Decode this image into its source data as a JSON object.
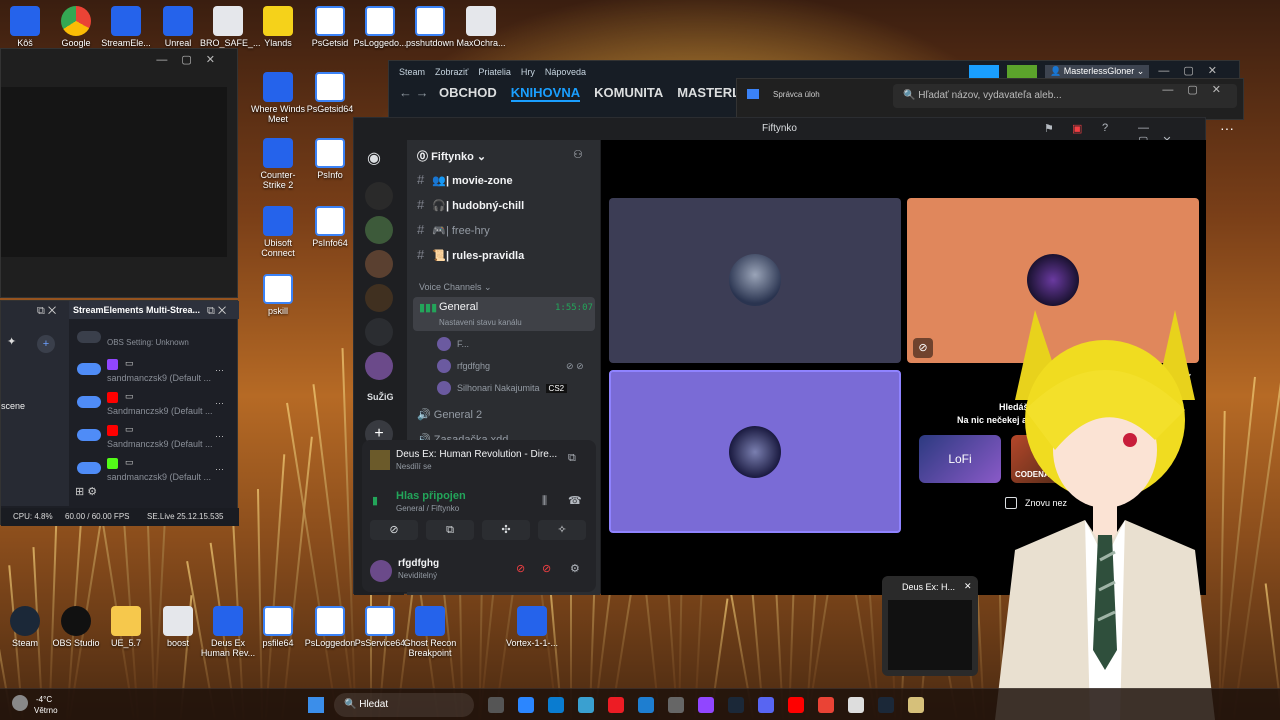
{
  "desktop": {
    "top_icons": [
      {
        "label": "Kôš",
        "icon": "recycle-bin-icon"
      },
      {
        "label": "Google",
        "icon": "chrome-icon"
      },
      {
        "label": "StreamEle...",
        "icon": "streamelements-icon"
      },
      {
        "label": "Unreal",
        "icon": "unreal-icon"
      },
      {
        "label": "BRO_SAFE_...",
        "icon": "gear-file-icon"
      },
      {
        "label": "Ylands",
        "icon": "ylands-icon"
      },
      {
        "label": "PsGetsid",
        "icon": "file-icon"
      },
      {
        "label": "PsLoggedo...",
        "icon": "file-icon"
      },
      {
        "label": "psshutdown",
        "icon": "file-icon"
      },
      {
        "label": "MaxOchra...",
        "icon": "gear-file-icon"
      }
    ],
    "col_icons": [
      {
        "label": "Where Winds Meet",
        "icon": "game-icon"
      },
      {
        "label": "PsGetsid64",
        "icon": "file-icon"
      },
      {
        "label": "Counter-Strike 2",
        "icon": "cs2-icon"
      },
      {
        "label": "PsInfo",
        "icon": "file-icon"
      },
      {
        "label": "Ubisoft Connect",
        "icon": "ubisoft-icon"
      },
      {
        "label": "PsInfo64",
        "icon": "file-icon"
      },
      {
        "label": "pskill",
        "icon": "file-icon"
      }
    ],
    "bottom_icons": [
      {
        "label": "Steam",
        "icon": "steam-icon"
      },
      {
        "label": "OBS Studio",
        "icon": "obs-icon"
      },
      {
        "label": "UE_5.7",
        "icon": "folder-icon"
      },
      {
        "label": "boost",
        "icon": "gear-file-icon"
      },
      {
        "label": "Deus Ex Human Rev...",
        "icon": "game-icon"
      },
      {
        "label": "psfile64",
        "icon": "file-icon"
      },
      {
        "label": "PsLoggedon",
        "icon": "file-icon"
      },
      {
        "label": "PsService64",
        "icon": "file-icon"
      },
      {
        "label": "Ghost Recon Breakpoint",
        "icon": "game-icon"
      },
      {
        "label": "Vortex-1-1-...",
        "icon": "vortex-icon"
      }
    ]
  },
  "steam": {
    "menu": [
      "Steam",
      "Zobraziť",
      "Priatelia",
      "Hry",
      "Nápoveda"
    ],
    "nav": [
      "OBCHOD",
      "KNIHOVNA",
      "KOMUNITA",
      "MASTERLESS"
    ],
    "active_nav": "KNIHOVNA",
    "username": "MasterlessGloner"
  },
  "task_manager": {
    "title": "Správca úloh",
    "search_placeholder": "Hľadať názov, vydavateľa aleb..."
  },
  "discord": {
    "title": "Fiftynko",
    "server_name": "Fiftynko",
    "text_channels": [
      {
        "name": "| movie-zone",
        "emoji": "👥"
      },
      {
        "name": "| hudobný-chill",
        "emoji": "🎧"
      },
      {
        "name": "| free-hry",
        "emoji": "🎮"
      },
      {
        "name": "| rules-pravidla",
        "emoji": "📜"
      }
    ],
    "voice_header": "Voice Channels",
    "voice_channel": "General",
    "voice_timer": "1:55:07",
    "voice_status": "Nastaveni stavu kanálu",
    "voice_members": [
      "F...",
      "rfgdfghg",
      "Silhonari Nakajumita"
    ],
    "member_badge": "CS2",
    "voice_channel_2": "General 2",
    "voice_channel_3": "Zasadačka xdd",
    "server_abbrev": "SuŽiG",
    "activity_title": "Deus Ex: Human Revolution - Dire...",
    "activity_sub": "Nesdílí se",
    "voice_connected": "Hlas připojen",
    "voice_connected_sub": "General / Fiftynko",
    "user_name": "rfgdfghg",
    "user_status": "Neviditelný",
    "popup_line1": "Hledáš něja",
    "popup_line2": "Na nic nečekej a pusť si",
    "popup_checkbox": "Znovu nez",
    "popup_game": "CODENAMES",
    "popup_game_2": "LoFi"
  },
  "obs": {
    "dock_title": "StreamElements Multi-Strea...",
    "setting": "OBS Setting: Unknown",
    "rows": [
      {
        "name": "sandmanczsk9 (Default ...",
        "platform": "twitch"
      },
      {
        "name": "Sandmanczsk9 (Default ...",
        "platform": "youtube"
      },
      {
        "name": "Sandmanczsk9 (Default ...",
        "platform": "youtube"
      },
      {
        "name": "sandmanczsk9 (Default ...",
        "platform": "kick"
      }
    ],
    "scene_label": "scene",
    "cpu": "CPU: 4.8%",
    "fps": "60.00 / 60.00 FPS",
    "se_live": "SE.Live 25.12.15.535"
  },
  "preview": {
    "title": "Deus Ex: H..."
  },
  "taskbar": {
    "weather_temp": "-4°C",
    "weather_desc": "Větrno",
    "search": "Hledat"
  },
  "colors": {
    "discord_accent": "#5865f2",
    "steam_accent": "#1a9fff",
    "green": "#23a55a"
  }
}
